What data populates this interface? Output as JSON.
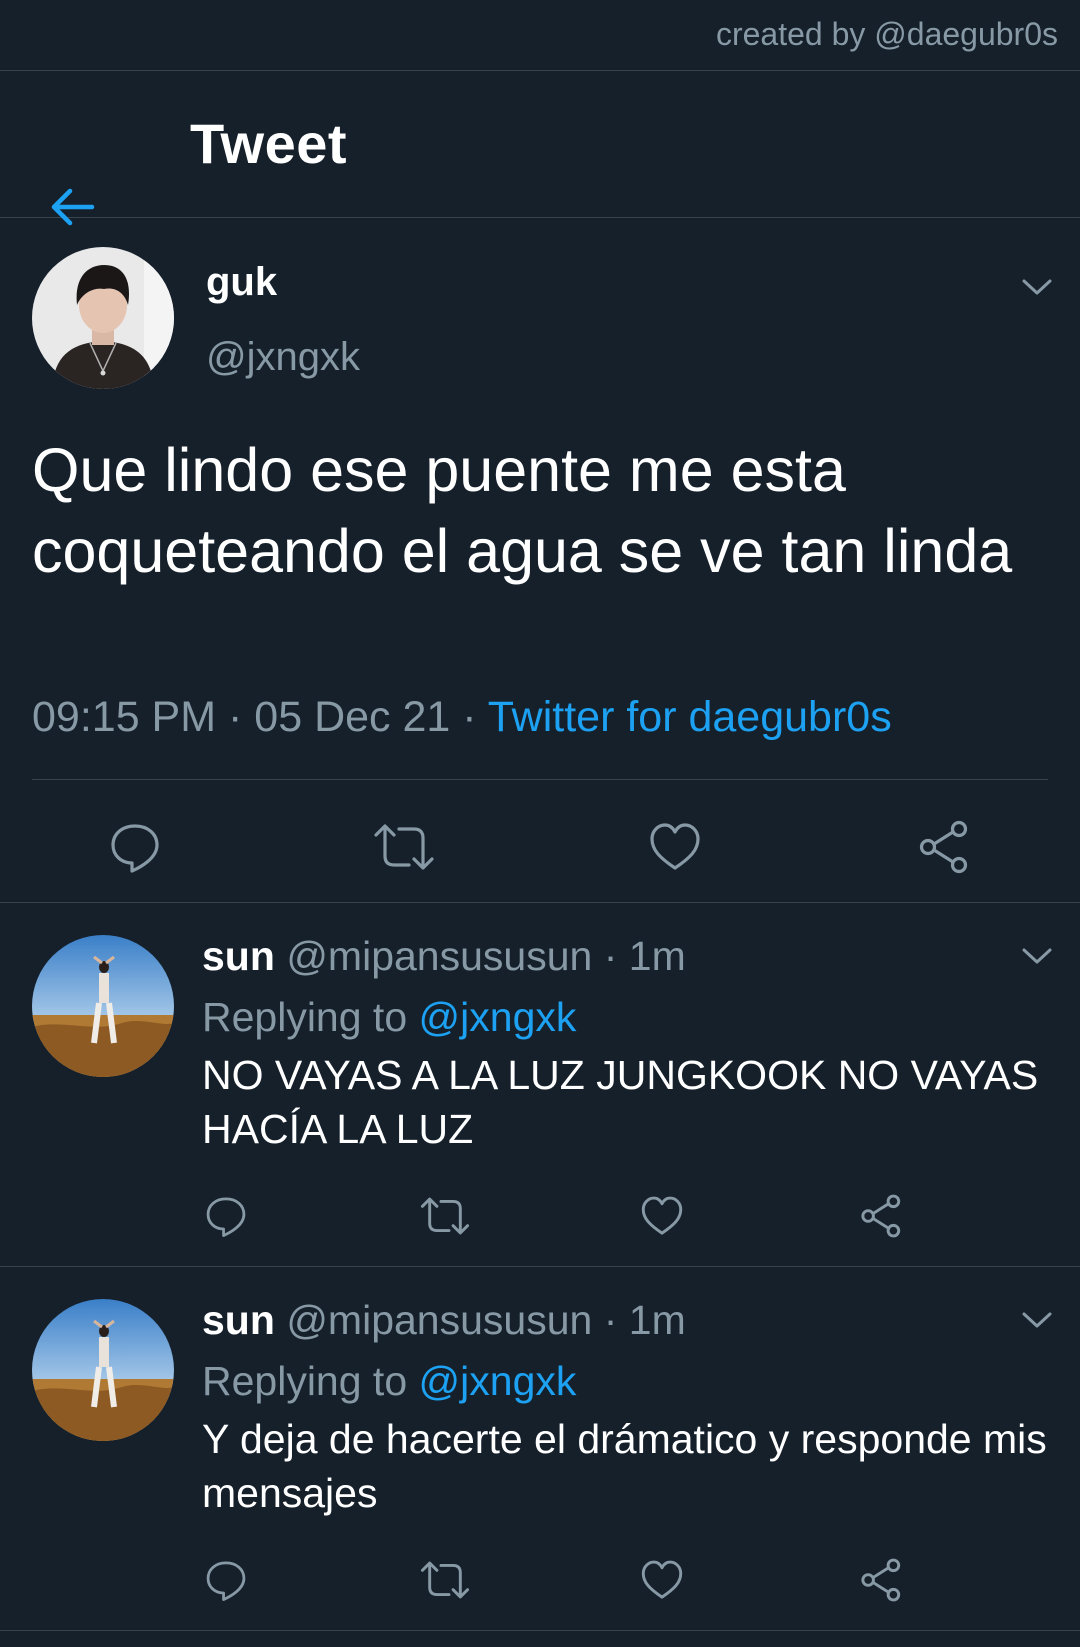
{
  "credit": "created by @daegubr0s",
  "header": {
    "title": "Tweet",
    "back_icon": "arrow-left-icon"
  },
  "colors": {
    "background": "#15202b",
    "accent": "#1da1f2",
    "muted": "#8899a6",
    "divider": "#38444d"
  },
  "main_tweet": {
    "display_name": "guk",
    "handle": "@jxngxk",
    "text": "Que lindo ese puente me esta coqueteando el agua se ve tan linda",
    "time": "09:15 PM",
    "date": "05 Dec 21",
    "separator": "·",
    "source": "Twitter for daegubr0s"
  },
  "replies": [
    {
      "display_name": "sun",
      "handle": "@mipansususun",
      "time": "1m",
      "replying_prefix": "Replying to",
      "replying_to": "@jxngxk",
      "text": "NO VAYAS A LA LUZ JUNGKOOK NO VAYAS HACÍA LA LUZ"
    },
    {
      "display_name": "sun",
      "handle": "@mipansususun",
      "time": "1m",
      "replying_prefix": "Replying to",
      "replying_to": "@jxngxk",
      "text": "Y deja de hacerte el drámatico y responde mis mensajes"
    }
  ],
  "actions": [
    "reply-icon",
    "retweet-icon",
    "like-icon",
    "share-icon"
  ]
}
